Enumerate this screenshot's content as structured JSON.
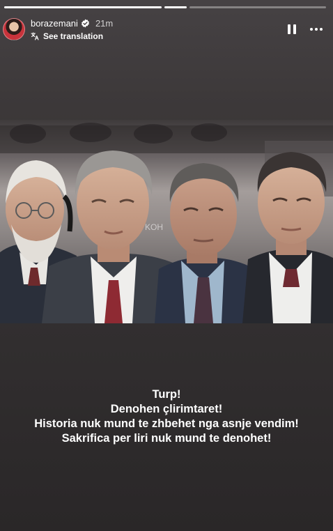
{
  "story": {
    "progress": [
      1,
      1,
      0
    ],
    "username": "borazemani",
    "verified": true,
    "time_ago": "21m",
    "translate_label": "See translation",
    "controls": {
      "pause_icon": "pause-icon",
      "more_icon": "more-options-icon"
    }
  },
  "post": {
    "image_watermark": "KOH",
    "caption_lines": [
      "Turp!",
      "Denohen çlirimtaret!",
      "Historia nuk mund te zhbehet nga asnje vendim!",
      "Sakrifica per liri nuk mund te denohet!"
    ]
  },
  "colors": {
    "background": "#2b2829",
    "text": "#ffffff",
    "verified_badge": "#ffffff"
  }
}
